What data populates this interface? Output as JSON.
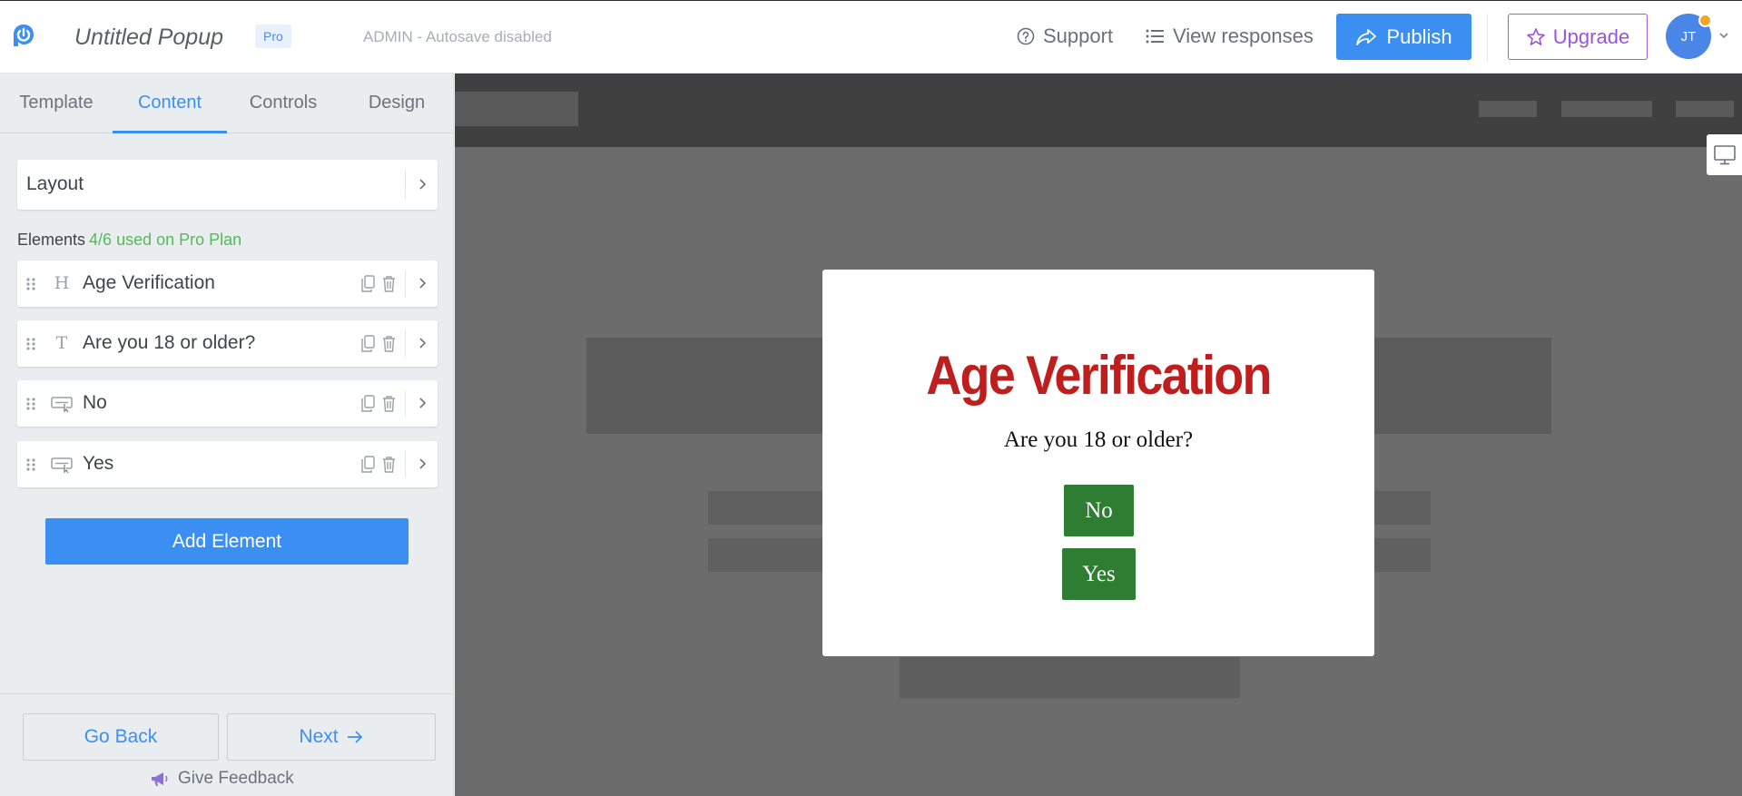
{
  "header": {
    "app_title": "Untitled Popup",
    "plan_badge": "Pro",
    "autosave_status": "ADMIN - Autosave disabled",
    "support_label": "Support",
    "view_responses_label": "View responses",
    "publish_label": "Publish",
    "upgrade_label": "Upgrade",
    "avatar_initials": "JT"
  },
  "sidebar": {
    "tabs": [
      {
        "label": "Template",
        "active": false
      },
      {
        "label": "Content",
        "active": true
      },
      {
        "label": "Controls",
        "active": false
      },
      {
        "label": "Design",
        "active": false
      }
    ],
    "layout_label": "Layout",
    "elements_heading": "Elements",
    "elements_usage": "4/6 used on Pro Plan",
    "elements": [
      {
        "icon": "heading-icon",
        "glyph": "H",
        "label": "Age Verification"
      },
      {
        "icon": "text-icon",
        "glyph": "T",
        "label": "Are you 18 or older?"
      },
      {
        "icon": "button-icon",
        "glyph": "",
        "label": "No"
      },
      {
        "icon": "button-icon",
        "glyph": "",
        "label": "Yes"
      }
    ],
    "add_element_label": "Add Element",
    "go_back_label": "Go Back",
    "next_label": "Next",
    "feedback_label": "Give Feedback"
  },
  "popup": {
    "title": "Age Verification",
    "question": "Are you 18 or older?",
    "no_label": "No",
    "yes_label": "Yes"
  },
  "colors": {
    "accent": "#3b8ff3",
    "upgrade": "#9b55dc",
    "plan_usage": "#58b85c",
    "popup_title": "#be1e1e",
    "popup_button": "#2e7d32"
  }
}
